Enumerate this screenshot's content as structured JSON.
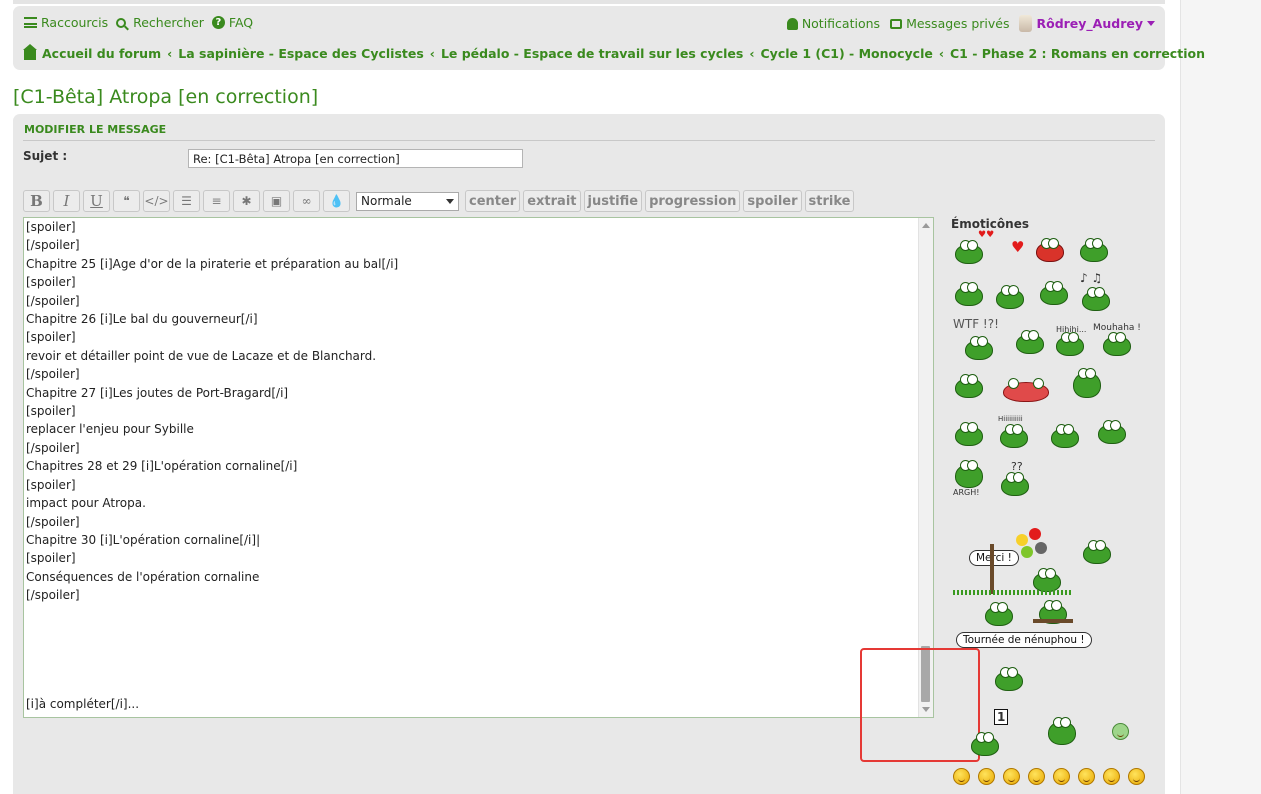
{
  "header": {
    "shortcuts": "Raccourcis",
    "search": "Rechercher",
    "faq": "FAQ",
    "notifications": "Notifications",
    "private_messages": "Messages privés",
    "username": "Rôdrey_Audrey"
  },
  "breadcrumbs": [
    "Accueil du forum",
    "La sapinière - Espace des Cyclistes",
    "Le pédalo - Espace de travail sur les cycles",
    "Cycle 1 (C1) - Monocycle",
    "C1 - Phase 2 : Romans en correction"
  ],
  "page": {
    "title": "[C1-Bêta] Atropa [en correction]"
  },
  "form": {
    "heading": "MODIFIER LE MESSAGE",
    "subject_label": "Sujet :",
    "subject_value": "Re: [C1-Bêta] Atropa [en correction]"
  },
  "toolbar": {
    "bold": "B",
    "italic": "I",
    "underline": "U",
    "quote": "❝",
    "code": "</>",
    "list": "☰",
    "numbered_list": "≡",
    "star": "✱",
    "image": "▣",
    "link": "∞",
    "color": "💧",
    "font_size_selected": "Normale",
    "custom_buttons": [
      "center",
      "extrait",
      "justifie",
      "progression",
      "spoiler",
      "strike"
    ]
  },
  "editor": {
    "lines": [
      "[spoiler]",
      "[/spoiler]",
      "Chapitre 25 [i]Age d'or de la piraterie et préparation au bal[/i]",
      "[spoiler]",
      "[/spoiler]",
      "Chapitre 26 [i]Le bal du gouverneur[/i]",
      "[spoiler]",
      "revoir et détailler point de vue de Lacaze et de Blanchard.",
      "[/spoiler]",
      "Chapitre 27 [i]Les joutes de Port-Bragard[/i]",
      "[spoiler]",
      "replacer l'enjeu pour Sybille",
      "[/spoiler]",
      "Chapitres 28 et 29 [i]L'opération cornaline[/i]",
      "[spoiler]",
      "impact pour Atropa.",
      "[/spoiler]",
      "Chapitre 30 [i]L'opération cornaline[/i]|",
      "[spoiler]",
      "Conséquences de l'opération cornaline",
      "[/spoiler]"
    ],
    "last_line": "[i]à compléter[/i]..."
  },
  "emoticons": {
    "title": "Émoticônes",
    "labels": {
      "wtf": "WTF !?!",
      "hihihi": "Hihihi...",
      "mouhaha": "Mouhaha !",
      "hiiii": "Hiiiiiiiiii",
      "argh": "ARGH!",
      "questions": "??",
      "merci": "Merci !",
      "tournee": "Tournée de nénuphou !",
      "one": "1"
    }
  },
  "colors": {
    "accent_green": "#3a8a1e",
    "user_purple": "#9b1fb5",
    "panel_gray": "#e8e8e8",
    "highlight_red": "#e53935"
  }
}
